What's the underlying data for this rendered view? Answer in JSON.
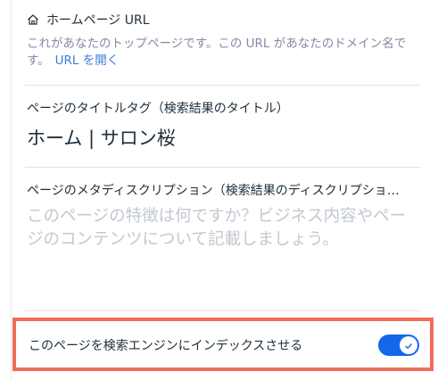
{
  "home_url": {
    "title": "ホームページ URL",
    "description": "これがあなたのトップページです。この URL があなたのドメイン名です。",
    "link_label": "URL を開く"
  },
  "title_tag": {
    "label": "ページのタイトルタグ（検索結果のタイトル）",
    "value": "ホーム | サロン桜"
  },
  "meta_description": {
    "label": "ページのメタディスクリプション（検索結果のディスクリプショ…",
    "placeholder": "このページの特徴は何ですか？ビジネス内容やページのコンテンツについて記載しましょう。"
  },
  "index_toggle": {
    "label": "このページを検索エンジンにインデックスさせる",
    "state": "on"
  },
  "colors": {
    "accent": "#1467eb",
    "link": "#3b7ddd",
    "highlight": "#ef6c5c"
  }
}
